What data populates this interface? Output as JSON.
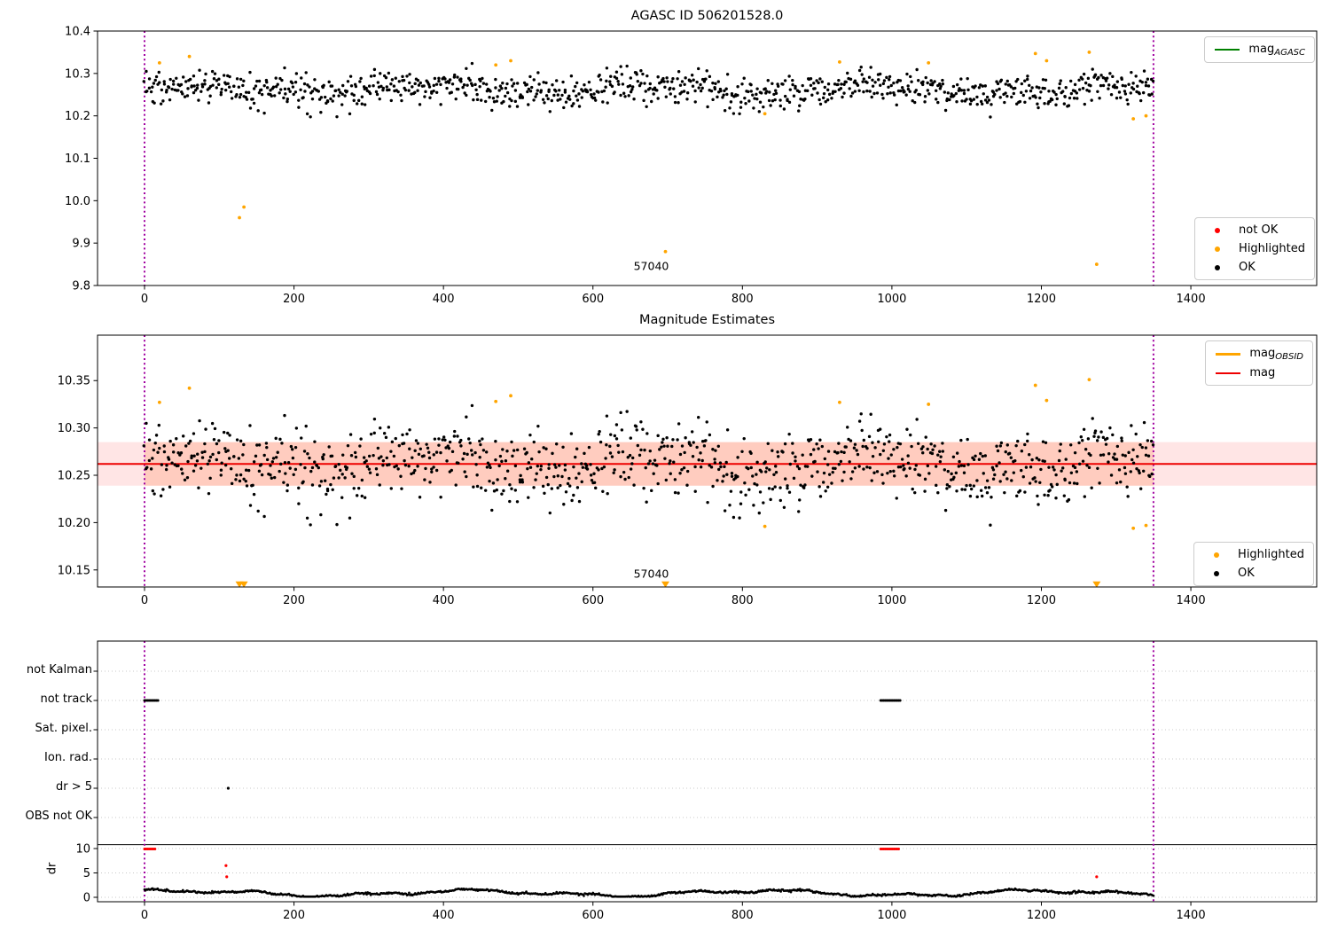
{
  "colors": {
    "point_ok": "#000000",
    "point_not_ok": "#ff0000",
    "point_highlighted": "#ffa500",
    "mag_line": "#ee0000",
    "agasc_line": "#008000",
    "obsid_line": "#ffa500",
    "band_outer": "rgba(255,0,0,0.10)",
    "band_inner": "rgba(255,120,60,0.22)",
    "vline": "#a000a0",
    "grid": "#c8c8c8",
    "axis": "#000000"
  },
  "chart_data": [
    {
      "type": "scatter",
      "title": "AGASC ID 506201528.0",
      "xlabel": "",
      "ylabel": "",
      "xlim": [
        -63,
        1568
      ],
      "ylim": [
        9.8,
        10.4
      ],
      "x_ticks": [
        0,
        200,
        400,
        600,
        800,
        1000,
        1200,
        1400
      ],
      "y_ticks": [
        9.8,
        9.9,
        10.0,
        10.1,
        10.2,
        10.3,
        10.4
      ],
      "y_tick_decimals": 1,
      "vlines": [
        0,
        1350
      ],
      "annotation": {
        "text": "57040",
        "x": 678,
        "y": 9.847
      },
      "legend_top": {
        "entries": [
          {
            "type": "line",
            "color": "#008000",
            "label": "mag",
            "sub": "AGASC"
          }
        ]
      },
      "legend_bottom": {
        "entries": [
          {
            "type": "dot",
            "color": "#ff0000",
            "label": "not OK"
          },
          {
            "type": "dot",
            "color": "#ffa500",
            "label": "Highlighted"
          },
          {
            "type": "dot",
            "color": "#000000",
            "label": "OK"
          }
        ]
      },
      "highlighted_points": [
        [
          20,
          10.325
        ],
        [
          60,
          10.34
        ],
        [
          127,
          9.96
        ],
        [
          133,
          9.985
        ],
        [
          470,
          10.32
        ],
        [
          490,
          10.33
        ],
        [
          697,
          9.88
        ],
        [
          830,
          10.205
        ],
        [
          930,
          10.327
        ],
        [
          1049,
          10.325
        ],
        [
          1192,
          10.347
        ],
        [
          1207,
          10.33
        ],
        [
          1264,
          10.35
        ],
        [
          1274,
          9.85
        ],
        [
          1323,
          10.193
        ],
        [
          1340,
          10.2
        ]
      ],
      "cloud": {
        "n": 1000,
        "x_range": [
          0,
          1350
        ],
        "mean": 10.262,
        "sigma": 0.02,
        "clamp": [
          10.193,
          10.325
        ],
        "seed": 1234,
        "note": "dense OK telemetry magnitudes, ~10.19-10.33 mag"
      }
    },
    {
      "type": "scatter",
      "title": "Magnitude Estimates",
      "xlabel": "",
      "ylabel": "",
      "xlim": [
        -63,
        1568
      ],
      "ylim": [
        10.132,
        10.398
      ],
      "x_ticks": [
        0,
        200,
        400,
        600,
        800,
        1000,
        1200,
        1400
      ],
      "y_ticks": [
        10.15,
        10.2,
        10.25,
        10.3,
        10.35
      ],
      "y_tick_decimals": 2,
      "vlines": [
        0,
        1350
      ],
      "mag_line_value": 10.262,
      "band": {
        "y_low": 10.239,
        "y_high": 10.285,
        "x_inner": [
          0,
          1350
        ]
      },
      "annotation": {
        "text": "57040",
        "x": 678,
        "y": 10.146
      },
      "triangles_x": [
        127,
        133,
        697,
        1274
      ],
      "triangles_y": 10.135,
      "legend_top": {
        "entries": [
          {
            "type": "line-thick",
            "color": "#ffa500",
            "label": "mag",
            "sub": "OBSID"
          },
          {
            "type": "line",
            "color": "#ee0000",
            "label": "mag"
          }
        ]
      },
      "legend_bottom": {
        "entries": [
          {
            "type": "dot",
            "color": "#ffa500",
            "label": "Highlighted"
          },
          {
            "type": "dot",
            "color": "#000000",
            "label": "OK"
          }
        ]
      },
      "highlighted_points": [
        [
          20,
          10.327
        ],
        [
          60,
          10.342
        ],
        [
          470,
          10.328
        ],
        [
          490,
          10.334
        ],
        [
          830,
          10.196
        ],
        [
          930,
          10.327
        ],
        [
          1049,
          10.325
        ],
        [
          1192,
          10.345
        ],
        [
          1207,
          10.329
        ],
        [
          1264,
          10.351
        ],
        [
          1323,
          10.194
        ],
        [
          1340,
          10.197
        ]
      ],
      "cloud": {
        "n": 1000,
        "x_range": [
          0,
          1350
        ],
        "mean": 10.262,
        "sigma": 0.02,
        "clamp": [
          10.193,
          10.325
        ],
        "seed": 1234,
        "note": "same magnitude estimates as top panel, zoomed y-scale"
      }
    },
    {
      "type": "flags",
      "title": "",
      "ylabel": "dr",
      "categories": [
        "not Kalman",
        "not track",
        "Sat. pixel.",
        "Ion. rad.",
        "dr > 5",
        "OBS not OK"
      ],
      "dr_ticks": [
        10,
        5,
        0
      ],
      "x_ticks": [
        0,
        200,
        400,
        600,
        800,
        1000,
        1200,
        1400
      ],
      "vlines": [
        0,
        1350
      ],
      "separator_line_dr": 10.8,
      "not_track_segments": [
        [
          0,
          18
        ],
        [
          985,
          1012
        ]
      ],
      "dr10_red_segments": [
        [
          0,
          15
        ],
        [
          985,
          1010
        ]
      ],
      "dr5_flag_points_x": [
        112
      ],
      "red_dr_points": [
        [
          109,
          6.5
        ],
        [
          110,
          4.2
        ],
        [
          1274,
          4.2
        ]
      ],
      "trace": {
        "n": 1000,
        "x_range": [
          0,
          1350
        ],
        "base": 0.85,
        "noise": 0.1,
        "clamp": [
          0.13,
          2.8
        ],
        "seed": 77,
        "note": "dr residual trace, wiggling between ~0.2 and ~2.5"
      }
    }
  ]
}
